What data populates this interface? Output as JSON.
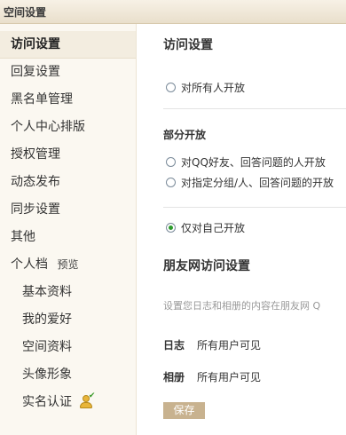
{
  "window": {
    "title": "空间设置"
  },
  "sidebar": {
    "items": [
      {
        "label": "访问设置"
      },
      {
        "label": "回复设置"
      },
      {
        "label": "黑名单管理"
      },
      {
        "label": "个人中心排版"
      },
      {
        "label": "授权管理"
      },
      {
        "label": "动态发布"
      },
      {
        "label": "同步设置"
      },
      {
        "label": "其他"
      },
      {
        "label": "个人档",
        "extra": "预览"
      },
      {
        "label": "基本资料"
      },
      {
        "label": "我的爱好"
      },
      {
        "label": "空间资料"
      },
      {
        "label": "头像形象"
      },
      {
        "label": "实名认证",
        "icon": "realname-verified-icon"
      }
    ]
  },
  "main": {
    "access_title": "访问设置",
    "option_all": "对所有人开放",
    "partial_title": "部分开放",
    "option_qq": "对QQ好友、回答问题的人开放",
    "option_group": "对指定分组/人、回答问题的开放",
    "option_self": "仅对自己开放",
    "friends_title": "朋友网访问设置",
    "friends_desc": "设置您日志和相册的内容在朋友网 Q",
    "rows": [
      {
        "label": "日志",
        "value": "所有用户可见"
      },
      {
        "label": "相册",
        "value": "所有用户可见"
      }
    ],
    "save_label": "保存"
  }
}
